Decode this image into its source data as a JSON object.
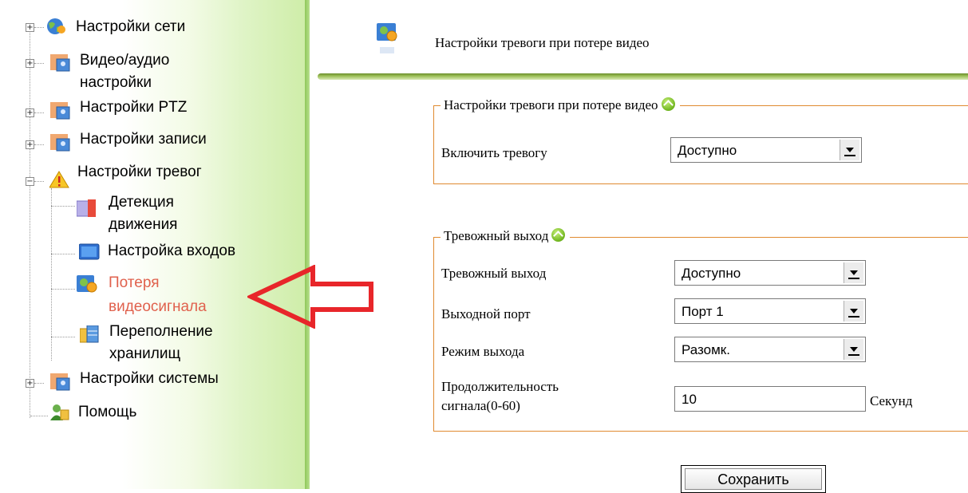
{
  "sidebar": {
    "items": [
      {
        "label": "Настройки сети",
        "expander": "+",
        "icon": "globe-icon"
      },
      {
        "label_line1": "Видео/аудио",
        "label_line2": "настройки",
        "expander": "+",
        "icon": "video-icon"
      },
      {
        "label": "Настройки PTZ",
        "expander": "+",
        "icon": "video-icon"
      },
      {
        "label": "Настройки записи",
        "expander": "+",
        "icon": "video-icon"
      },
      {
        "label": "Настройки тревог",
        "expander": "−",
        "icon": "warning-icon"
      },
      {
        "label_line1": "Детекция",
        "label_line2": "движения",
        "icon": "motion-icon"
      },
      {
        "label": "Настройка входов",
        "icon": "monitor-icon"
      },
      {
        "label_line1": "Потеря",
        "label_line2": "видеосигнала",
        "icon": "video-loss-icon",
        "active": true
      },
      {
        "label_line1": "Переполнение",
        "label_line2": "хранилищ",
        "icon": "storage-icon"
      },
      {
        "label": "Настройки системы",
        "expander": "+",
        "icon": "video-icon"
      },
      {
        "label": "Помощь",
        "icon": "help-icon"
      }
    ]
  },
  "header": {
    "title": "Настройки тревоги при потере видео",
    "icon": "video-loss-icon"
  },
  "section1": {
    "legend": "Настройки тревоги при потере видео",
    "enable_label": "Включить тревогу",
    "enable_value": "Доступно"
  },
  "section2": {
    "legend": "Тревожный выход",
    "output_label": "Тревожный выход",
    "output_value": "Доступно",
    "port_label": "Выходной порт",
    "port_value": "Порт 1",
    "mode_label": "Режим выхода",
    "mode_value": "Разомк.",
    "duration_label_line1": "Продолжительность",
    "duration_label_line2": "сигнала(0-60)",
    "duration_value": "10",
    "duration_unit": "Секунд"
  },
  "save_label": "Сохранить",
  "colors": {
    "accent_green": "#8fc85a",
    "fieldset_border": "#e08a30",
    "active_item": "#e0614d",
    "arrow": "#e8262a"
  }
}
